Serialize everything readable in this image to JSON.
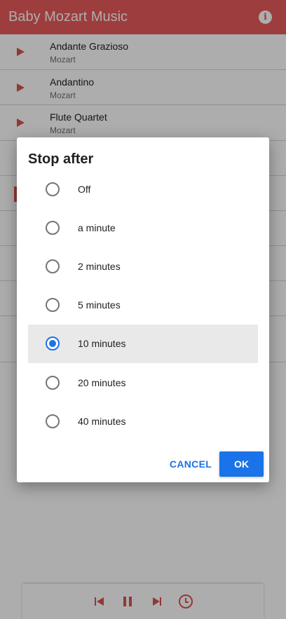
{
  "app": {
    "title": "Baby Mozart Music",
    "info_icon": "info-icon",
    "accent": "#e85a5a"
  },
  "tracks": [
    {
      "title": "Andante Grazioso",
      "artist": "Mozart"
    },
    {
      "title": "Andantino",
      "artist": "Mozart"
    },
    {
      "title": "Flute Quartet",
      "artist": "Mozart"
    }
  ],
  "player": {
    "prev_icon": "skip-previous-icon",
    "pause_icon": "pause-icon",
    "next_icon": "skip-next-icon",
    "timer_icon": "timer-icon"
  },
  "dialog": {
    "title": "Stop after",
    "options": [
      {
        "label": "Off",
        "selected": false
      },
      {
        "label": "a minute",
        "selected": false
      },
      {
        "label": "2 minutes",
        "selected": false
      },
      {
        "label": "5 minutes",
        "selected": false
      },
      {
        "label": "10 minutes",
        "selected": true
      },
      {
        "label": "20 minutes",
        "selected": false
      },
      {
        "label": "40 minutes",
        "selected": false
      }
    ],
    "cancel_label": "CANCEL",
    "ok_label": "OK",
    "button_color": "#1a73e8"
  }
}
